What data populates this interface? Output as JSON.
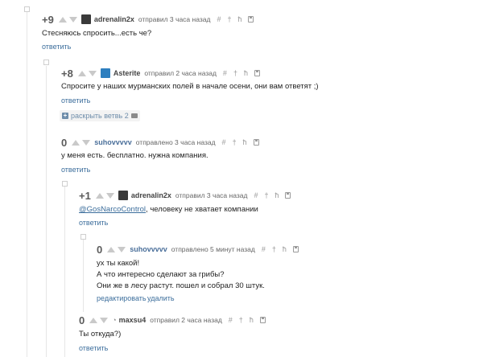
{
  "comments": [
    {
      "rating": "+9",
      "username": "adrenalin2x",
      "meta": "отправил 3 часа назад",
      "lines": [
        "Стесняюсь спросить...есть че?"
      ],
      "actions": [
        "ответить"
      ]
    },
    {
      "rating": "+8",
      "username": "Asterite",
      "meta": "отправил 2 часа назад",
      "lines": [
        "Спросите у наших мурманских полей в начале осени, они вам ответят ;)"
      ],
      "actions": [
        "ответить"
      ],
      "expand_label": "раскрыть ветвь 2"
    },
    {
      "rating": "0",
      "username": "suhovvvvv",
      "meta": "отправлено 3 часа назад",
      "lines": [
        "у меня есть. бесплатно. нужна компания."
      ],
      "actions": [
        "ответить"
      ]
    },
    {
      "rating": "+1",
      "username": "adrenalin2x",
      "meta": "отправил 3 часа назад",
      "mention": "@GosNarcoControl",
      "lines": [
        ", человеку не хватает компании"
      ],
      "actions": [
        "ответить"
      ]
    },
    {
      "rating": "0",
      "username": "suhovvvvv",
      "meta": "отправлено 5 минут назад",
      "lines": [
        "ух ты какой!",
        "А что интересно сделают за грибы?",
        "Они же в лесу растут. пошел и собрал 30 штук."
      ],
      "actions": [
        "редактировать",
        "удалить"
      ]
    },
    {
      "rating": "0",
      "username": "maxsu4",
      "meta": "отправил 2 часа назад",
      "lines": [
        "Ты откуда?)"
      ],
      "actions": [
        "ответить"
      ]
    }
  ],
  "tools": [
    "#",
    "†",
    "ħ"
  ],
  "icons": {
    "avatar_adrenalin": "avatar-dark",
    "avatar_asterite": "avatar-blue",
    "avatar_maxsu4": "avatar-rss"
  },
  "colors": {
    "link": "#3c6e9c",
    "rating": "#5b5b5b",
    "arrow": "#c9c9c9",
    "thread_line": "#e6e6e6"
  }
}
